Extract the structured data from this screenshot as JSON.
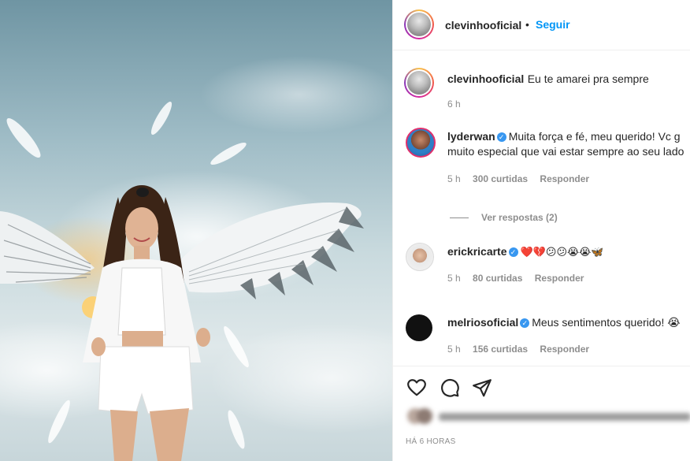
{
  "post": {
    "username": "clevinhooficial",
    "follow_label": "Seguir",
    "caption": "Eu te amarei pra sempre",
    "caption_time": "6 h"
  },
  "comments": [
    {
      "username": "lyderwan",
      "verified": true,
      "text_line1": "Muita força e fé, meu querido! Vc g",
      "text_line2": "muito especial que vai estar sempre ao seu lado",
      "time": "5 h",
      "likes": "300 curtidas",
      "reply_label": "Responder",
      "view_replies": "Ver respostas (2)"
    },
    {
      "username": "erickricarte",
      "verified": true,
      "text": "❤️💔😕😕😭😭🦋",
      "time": "5 h",
      "likes": "80 curtidas",
      "reply_label": "Responder"
    },
    {
      "username": "melriosoficial",
      "verified": true,
      "text": "Meus sentimentos querido! 😭",
      "time": "5 h",
      "likes": "156 curtidas",
      "reply_label": "Responder"
    }
  ],
  "actions": {
    "icons": [
      "heart-icon",
      "comment-icon",
      "share-icon"
    ]
  },
  "footer": {
    "timestamp": "HÁ 6 HORAS"
  },
  "colors": {
    "accent": "#0095f6",
    "verified": "#3897f0",
    "heart": "#ed4956",
    "muted": "#8e8e8e"
  }
}
